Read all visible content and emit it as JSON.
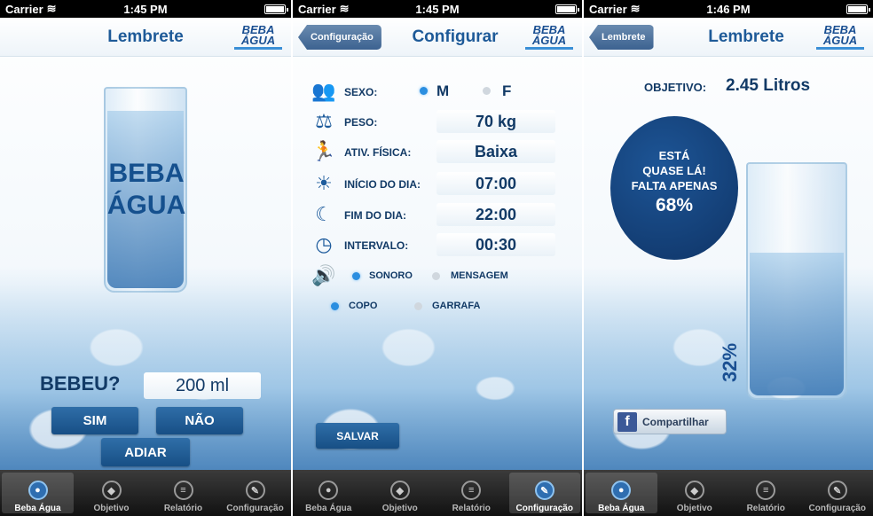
{
  "status": {
    "carrier": "Carrier",
    "times": [
      "1:45 PM",
      "1:45 PM",
      "1:46 PM"
    ]
  },
  "logo_text": "BEBA ÁGUA",
  "tabs": [
    "Beba Água",
    "Objetivo",
    "Relatório",
    "Configuração"
  ],
  "screen1": {
    "title": "Lembrete",
    "glass_text_line1": "BEBA",
    "glass_text_line2": "ÁGUA",
    "question": "BEBEU?",
    "amount": "200 ml",
    "yes_button": "SIM",
    "no_button": "NÃO",
    "postpone_button": "ADIAR",
    "active_tab": 0
  },
  "screen2": {
    "back_button": "Configuração",
    "title": "Configurar",
    "rows": {
      "sexo_label": "SEXO:",
      "sexo_m": "M",
      "sexo_f": "F",
      "peso_label": "PESO:",
      "peso_value": "70 kg",
      "atividade_label": "ATIV. FÍSICA:",
      "atividade_value": "Baixa",
      "inicio_label": "INÍCIO DO DIA:",
      "inicio_value": "07:00",
      "fim_label": "FIM DO DIA:",
      "fim_value": "22:00",
      "intervalo_label": "INTERVALO:",
      "intervalo_value": "00:30",
      "sonoro_label": "SONORO",
      "mensagem_label": "MENSAGEM",
      "copo_label": "COPO",
      "garrafa_label": "GARRAFA"
    },
    "save_button": "SALVAR",
    "active_tab": 3
  },
  "screen3": {
    "back_button": "Lembrete",
    "title": "Lembrete",
    "objective_label": "OBJETIVO:",
    "objective_value": "2.45 Litros",
    "circle_line1": "ESTÁ",
    "circle_line2": "QUASE LÁ!",
    "circle_line3": "FALTA APENAS",
    "circle_percent": "68%",
    "progress_percent": "32%",
    "progress_fraction": 0.32,
    "share_button": "Compartilhar",
    "active_tab": 0
  },
  "colors": {
    "brand_blue": "#1e5a98",
    "button_blue": "#174f85",
    "circle_blue": "#123b73",
    "radio_on": "#2a8ee0"
  }
}
